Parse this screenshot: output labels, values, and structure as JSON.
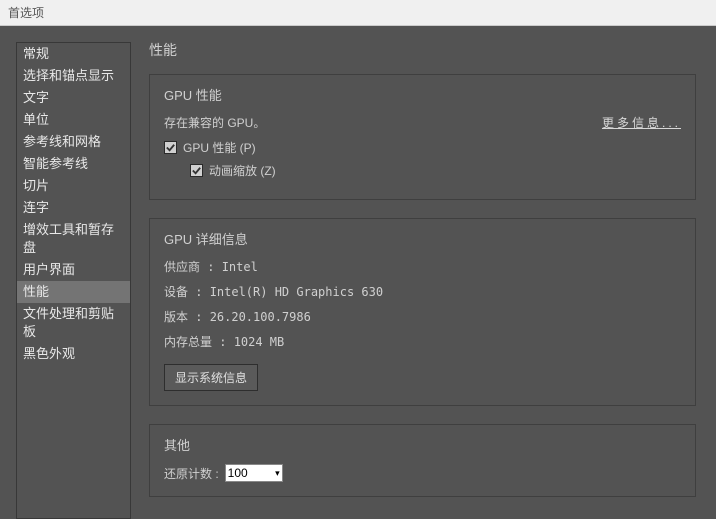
{
  "window": {
    "title": "首选项"
  },
  "sidebar": {
    "items": [
      {
        "label": "常规"
      },
      {
        "label": "选择和锚点显示"
      },
      {
        "label": "文字"
      },
      {
        "label": "单位"
      },
      {
        "label": "参考线和网格"
      },
      {
        "label": "智能参考线"
      },
      {
        "label": "切片"
      },
      {
        "label": "连字"
      },
      {
        "label": "增效工具和暂存盘"
      },
      {
        "label": "用户界面"
      },
      {
        "label": "性能"
      },
      {
        "label": "文件处理和剪贴板"
      },
      {
        "label": "黑色外观"
      }
    ],
    "selected_index": 10
  },
  "page": {
    "title": "性能",
    "gpu_perf": {
      "title": "GPU 性能",
      "status": "存在兼容的 GPU。",
      "more_info": "更多信息...",
      "gpu_checkbox_label": "GPU 性能 (P)",
      "gpu_checked": true,
      "anim_zoom_label": "动画缩放 (Z)",
      "anim_zoom_checked": true
    },
    "gpu_details": {
      "title": "GPU 详细信息",
      "vendor_label": "供应商 :",
      "vendor_value": "Intel",
      "device_label": "设备 :",
      "device_value": "Intel(R) HD Graphics 630",
      "version_label": "版本 :",
      "version_value": "26.20.100.7986",
      "memory_label": "内存总量 :",
      "memory_value": "1024 MB",
      "show_sys_info": "显示系统信息"
    },
    "other": {
      "title": "其他",
      "undo_label": "还原计数 :",
      "undo_value": "100"
    }
  }
}
